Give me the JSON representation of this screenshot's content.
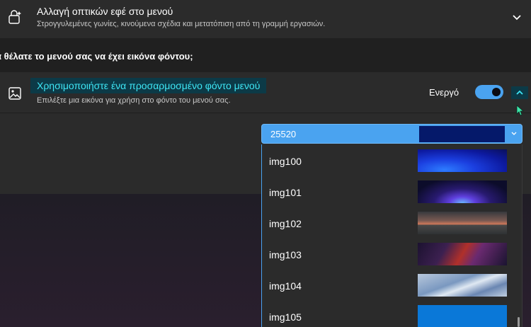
{
  "visual_effects": {
    "title": "Αλλαγή οπτικών εφέ στο μενού",
    "subtitle": "Στρογγυλεμένες γωνίες, κινούμενα σχέδια και μετατόπιση από τη γραμμή εργασιών."
  },
  "question": "α θέλατε το μενού σας να έχει εικόνα φόντου;",
  "background_setting": {
    "title": "Χρησιμοποιήστε ένα προσαρμοσμένο φόντο μενού",
    "subtitle": "Επιλέξτε μια εικόνα για χρήση στο φόντο του μενού σας.",
    "toggle_state_label": "Ενεργό",
    "toggle_on": true
  },
  "image_select": {
    "selected_value": "25520",
    "selected_swatch_color": "#05196a",
    "options": [
      {
        "label": "img100"
      },
      {
        "label": "img101"
      },
      {
        "label": "img102"
      },
      {
        "label": "img103"
      },
      {
        "label": "img104"
      },
      {
        "label": "img105"
      }
    ]
  },
  "colors": {
    "accent": "#4aa3f0",
    "highlight_text": "#3ee6f5",
    "highlight_bg": "#0c3a47"
  },
  "icons": [
    "sparkle-settings-icon",
    "chevron-down-icon",
    "image-icon",
    "chevron-up-icon",
    "mouse-cursor-icon"
  ]
}
